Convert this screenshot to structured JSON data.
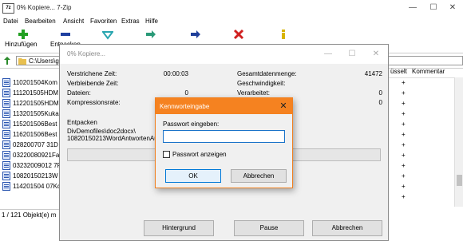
{
  "window": {
    "title": "0% Kopiere... 7-Zip",
    "app_icon": "7z"
  },
  "menu": [
    "Datei",
    "Bearbeiten",
    "Ansicht",
    "Favoriten",
    "Extras",
    "Hilfe"
  ],
  "toolbar": [
    {
      "label": "Hinzufügen",
      "icon": "plus-icon",
      "color": "#22a022"
    },
    {
      "label": "Entpacken",
      "icon": "minus-icon",
      "color": "#1f3fa0"
    },
    {
      "label": "Überprüfen",
      "icon": "check-icon",
      "color": "#2aa6b0"
    },
    {
      "label": "Kopieren",
      "icon": "arrow-right-icon",
      "color": "#2a9a78"
    },
    {
      "label": "Verschieben",
      "icon": "arrow-right-icon",
      "color": "#1f3f9a"
    },
    {
      "label": "Löschen",
      "icon": "x-icon",
      "color": "#d02020"
    },
    {
      "label": "Eigenschaften",
      "icon": "info-icon",
      "color": "#d8b400"
    }
  ],
  "address": {
    "path": "C:\\Users\\g"
  },
  "files": [
    "110201504Kom",
    "111201505HDM",
    "112201505HDM",
    "113201505Kuka",
    "115201506Best",
    "116201506Best",
    "028200707 31D",
    "03220080921Fa",
    "03232009012 7Fr",
    "10820150213W",
    "114201504 07Kc"
  ],
  "columns": {
    "encrypted_trunc": "üsselt",
    "comment": "Kommentar"
  },
  "encrypted_marks": [
    "+",
    "+",
    "+",
    "+",
    "+",
    "+",
    "+",
    "+",
    "+",
    "+",
    "+",
    "+"
  ],
  "status": "1 / 121 Objekt(e) m",
  "progress": {
    "title": "0% Kopiere...",
    "left_stats": [
      {
        "label": "Verstrichene Zeit:",
        "value": "00:00:03"
      },
      {
        "label": "Verbleibende Zeit:",
        "value": ""
      },
      {
        "label": "Dateien:",
        "value": "0"
      },
      {
        "label": "Kompressionsrate:",
        "value": ""
      }
    ],
    "right_stats": [
      {
        "label": "Gesamtdatenmenge:",
        "value": "41472"
      },
      {
        "label": "Geschwindigkeit:",
        "value": ""
      },
      {
        "label": "Verarbeitet:",
        "value": "0"
      },
      {
        "label": "",
        "value": "0"
      }
    ],
    "operation": "Entpacken",
    "path_line1": "DivDemofiles\\doc2docx\\",
    "path_line2": "10820150213WordAntwortenAusbl",
    "percent": 0,
    "buttons": {
      "background": "Hintergrund",
      "pause": "Pause",
      "cancel": "Abbrechen"
    }
  },
  "password_dialog": {
    "title": "Kennworteingabe",
    "label": "Passwort eingeben:",
    "value": "",
    "show_password_label": "Passwort anzeigen",
    "show_password_checked": false,
    "ok": "OK",
    "cancel": "Abbrechen",
    "accent": "#f58220"
  }
}
